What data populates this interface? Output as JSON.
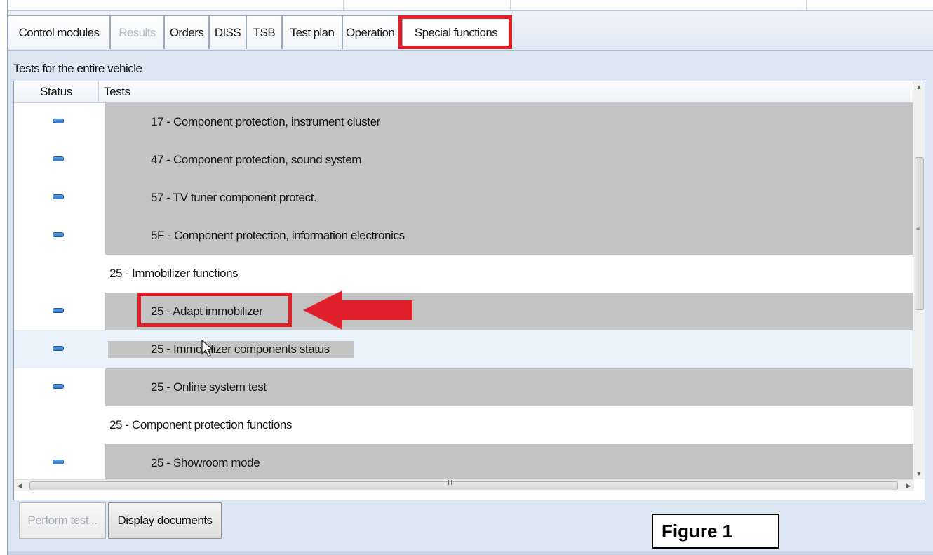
{
  "tabs": [
    {
      "label": "Control modules",
      "state": "normal"
    },
    {
      "label": "Results",
      "state": "disabled"
    },
    {
      "label": "Orders",
      "state": "normal"
    },
    {
      "label": "DISS",
      "state": "normal"
    },
    {
      "label": "TSB",
      "state": "normal"
    },
    {
      "label": "Test plan",
      "state": "normal"
    },
    {
      "label": "Operation",
      "state": "normal"
    },
    {
      "label": "Special functions",
      "state": "active"
    }
  ],
  "section_label": "Tests for the entire vehicle",
  "grid": {
    "columns": {
      "status": "Status",
      "tests": "Tests"
    },
    "rows": [
      {
        "kind": "test",
        "label": "17 - Component protection, instrument cluster",
        "status_icon": "blue-status-pill"
      },
      {
        "kind": "test",
        "label": "47 - Component protection, sound system",
        "status_icon": "blue-status-pill"
      },
      {
        "kind": "test",
        "label": "57 - TV tuner component protect.",
        "status_icon": "blue-status-pill"
      },
      {
        "kind": "test",
        "label": "5F - Component protection, information electronics",
        "status_icon": "blue-status-pill"
      },
      {
        "kind": "group",
        "label": "25 - Immobilizer functions"
      },
      {
        "kind": "test",
        "label": "25 - Adapt immobilizer",
        "status_icon": "blue-status-pill",
        "highlighted": true
      },
      {
        "kind": "test",
        "label": "25 - Immobilizer components status",
        "status_icon": "blue-status-pill",
        "selected": true
      },
      {
        "kind": "test",
        "label": "25 - Online system test",
        "status_icon": "blue-status-pill"
      },
      {
        "kind": "group",
        "label": "25 - Component protection functions"
      },
      {
        "kind": "test",
        "label": "25 - Showroom mode",
        "status_icon": "blue-status-pill"
      }
    ]
  },
  "buttons": {
    "perform_test": "Perform test...",
    "display_documents": "Display documents"
  },
  "figure_label": "Figure 1",
  "colors": {
    "annotation_red": "#e0212b",
    "row_gray": "#c3c3c3",
    "status_blue": "#2b6fc0",
    "window_bg": "#dde7f3"
  }
}
